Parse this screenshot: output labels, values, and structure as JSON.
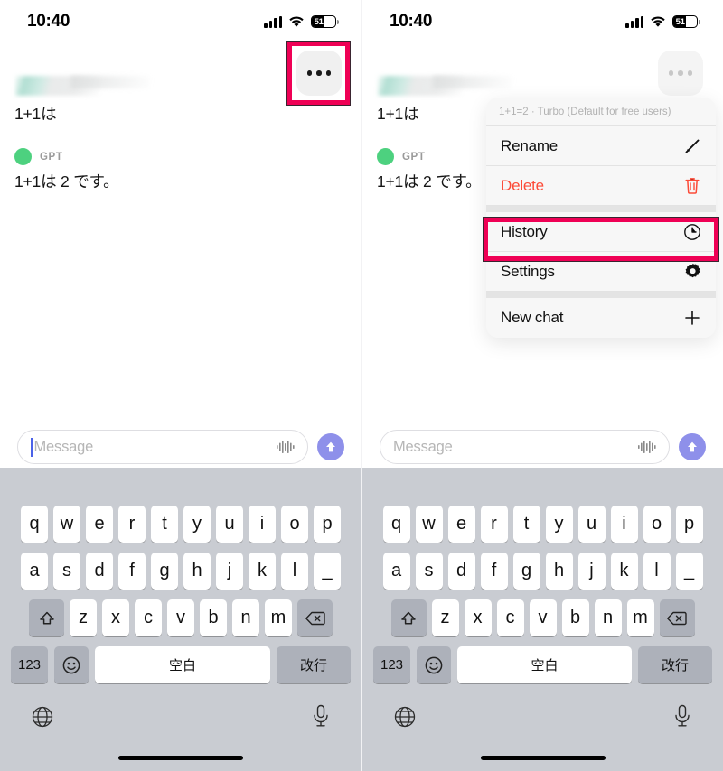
{
  "statusbar": {
    "time": "10:40",
    "battery_percent": "51",
    "signal_icon": "cellular-bars-icon",
    "wifi_icon": "wifi-icon",
    "battery_icon": "battery-icon"
  },
  "chat": {
    "more_button_label": "•••",
    "user_message": "1+1は",
    "bot_name": "GPT",
    "bot_message": "1+1は 2 です。"
  },
  "menu": {
    "header": "1+1=2 · Turbo (Default for free users)",
    "items": [
      {
        "label": "Rename",
        "icon": "pencil-icon"
      },
      {
        "label": "Delete",
        "icon": "trash-icon"
      },
      {
        "label": "History",
        "icon": "clock-icon"
      },
      {
        "label": "Settings",
        "icon": "gear-icon"
      },
      {
        "label": "New chat",
        "icon": "plus-icon"
      }
    ]
  },
  "input": {
    "placeholder": "Message",
    "value": "",
    "dictation_icon": "waveform-icon",
    "send_icon": "arrow-up-icon"
  },
  "keyboard": {
    "row1": [
      "q",
      "w",
      "e",
      "r",
      "t",
      "y",
      "u",
      "i",
      "o",
      "p"
    ],
    "row2": [
      "a",
      "s",
      "d",
      "f",
      "g",
      "h",
      "j",
      "k",
      "l",
      "_"
    ],
    "row3": [
      "z",
      "x",
      "c",
      "v",
      "b",
      "n",
      "m"
    ],
    "shift_icon": "shift-icon",
    "backspace_icon": "backspace-icon",
    "numeric_label": "123",
    "emoji_icon": "emoji-icon",
    "space_label": "空白",
    "return_label": "改行",
    "globe_icon": "globe-icon",
    "mic_icon": "microphone-icon"
  },
  "highlight": {
    "color": "#ef0055",
    "left_target": "more-button",
    "right_target": "menu-item-history"
  }
}
